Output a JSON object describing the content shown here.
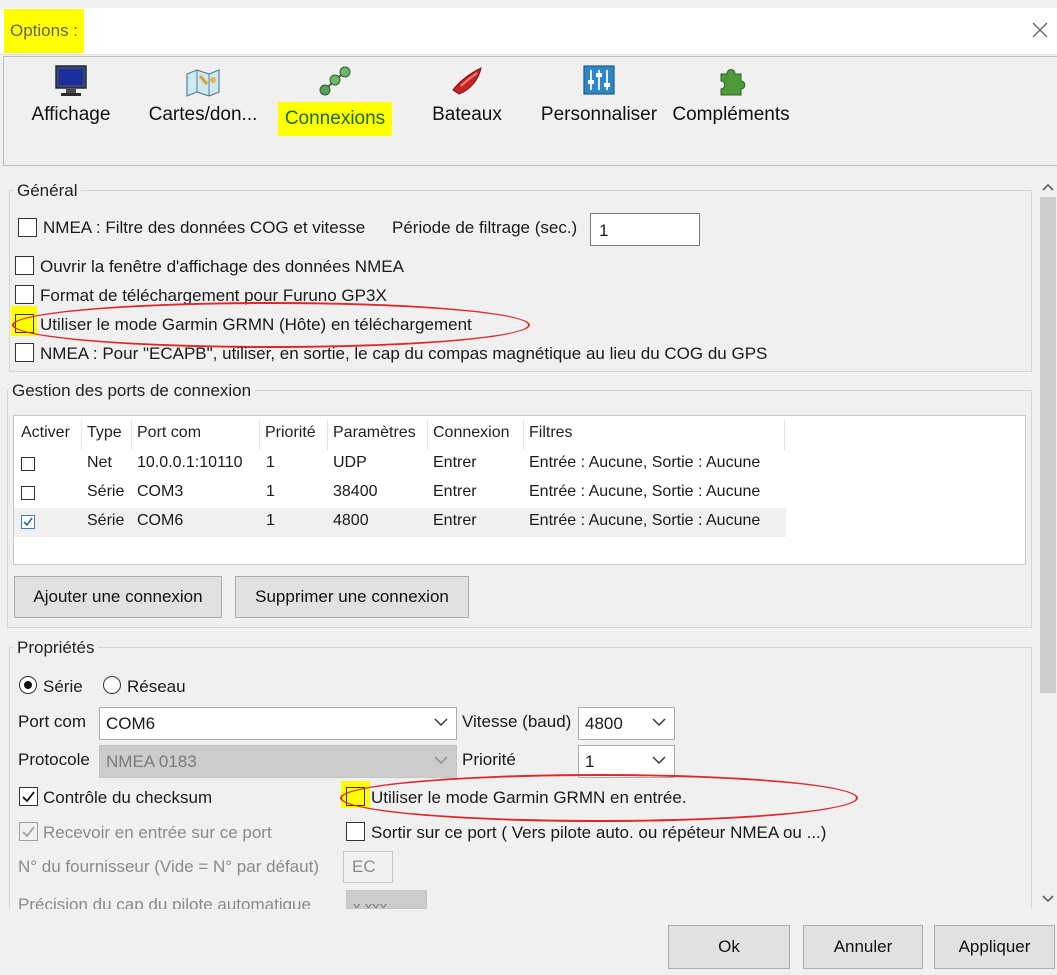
{
  "window": {
    "title": "Options :"
  },
  "toolbar": {
    "items": [
      {
        "label": "Affichage",
        "icon": "monitor-icon"
      },
      {
        "label": "Cartes/don...",
        "icon": "charts-icon"
      },
      {
        "label": "Connexions",
        "icon": "connections-icon",
        "selected": true
      },
      {
        "label": "Bateaux",
        "icon": "boat-icon"
      },
      {
        "label": "Personnaliser",
        "icon": "sliders-icon"
      },
      {
        "label": "Compléments",
        "icon": "puzzle-icon"
      }
    ]
  },
  "general": {
    "title": "Général",
    "nmea_filter_label": "NMEA : Filtre des données COG et vitesse",
    "filter_period_label": "Période de filtrage (sec.)",
    "filter_period_value": "1",
    "open_nmea_window": "Ouvrir la fenêtre d'affichage des données NMEA",
    "furuno_format": "Format de téléchargement pour Furuno GP3X",
    "garmin_host": "Utiliser le mode Garmin GRMN (Hôte) en téléchargement",
    "ecapb": "NMEA : Pour \"ECAPB\", utiliser, en sortie, le cap du compas magnétique  au lieu du COG du GPS"
  },
  "ports": {
    "title": "Gestion des ports de connexion",
    "columns": [
      "Activer",
      "Type",
      "Port com",
      "Priorité",
      "Paramètres",
      "Connexion",
      "Filtres"
    ],
    "rows": [
      {
        "enabled": false,
        "type": "Net",
        "port": "10.0.0.1:10110",
        "priority": "1",
        "params": "UDP",
        "connection": "Entrer",
        "filters": "Entrée : Aucune, Sortie : Aucune"
      },
      {
        "enabled": false,
        "type": "Série",
        "port": "COM3",
        "priority": "1",
        "params": "38400",
        "connection": "Entrer",
        "filters": "Entrée : Aucune, Sortie : Aucune"
      },
      {
        "enabled": true,
        "type": "Série",
        "port": "COM6",
        "priority": "1",
        "params": "4800",
        "connection": "Entrer",
        "filters": "Entrée : Aucune, Sortie : Aucune"
      }
    ],
    "add_button": "Ajouter une connexion",
    "remove_button": "Supprimer une connexion"
  },
  "properties": {
    "title": "Propriétés",
    "radio_serial": "Série",
    "radio_network": "Réseau",
    "port_label": "Port com",
    "port_value": "COM6",
    "baud_label": "Vitesse (baud)",
    "baud_value": "4800",
    "protocol_label": "Protocole",
    "protocol_value": "NMEA 0183",
    "priority_label": "Priorité",
    "priority_value": "1",
    "checksum_label": "Contrôle du checksum",
    "garmin_input_label": "Utiliser le mode Garmin GRMN en entrée.",
    "receive_label": "Recevoir en entrée sur ce port",
    "output_label": "Sortir sur ce port ( Vers pilote auto. ou répéteur NMEA ou ...)",
    "supplier_label": "N° du fournisseur (Vide = N° par défaut)",
    "supplier_value": "EC",
    "autopilot_label": "Précision du cap du pilote automatique",
    "autopilot_value": "x.xxx"
  },
  "footer": {
    "ok": "Ok",
    "cancel": "Annuler",
    "apply": "Appliquer"
  },
  "colors": {
    "highlight": "#ffff00",
    "annotation": "#e0282a",
    "selected_label": "#1b6b1b"
  }
}
